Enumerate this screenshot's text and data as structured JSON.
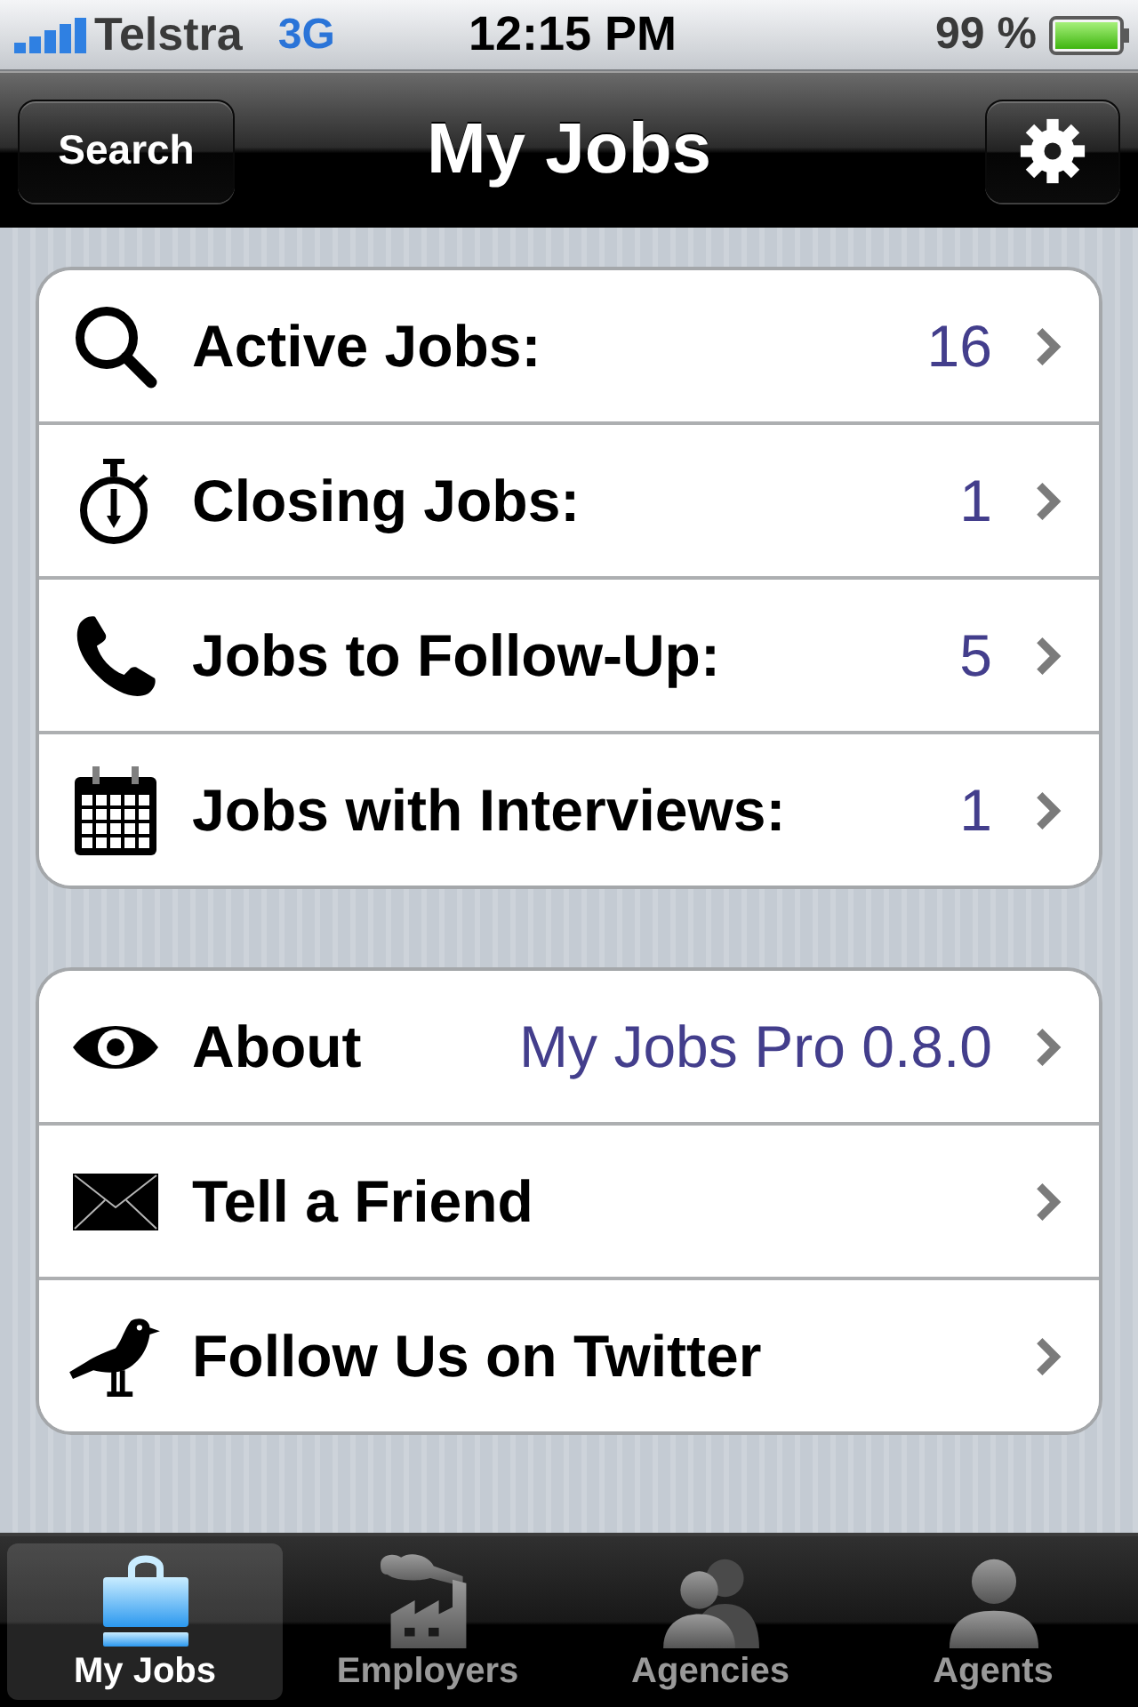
{
  "status_bar": {
    "carrier": "Telstra",
    "network": "3G",
    "time": "12:15 PM",
    "battery": "99 %"
  },
  "nav_bar": {
    "left_button": "Search",
    "title": "My Jobs"
  },
  "groups": [
    {
      "rows": [
        {
          "kind": "search",
          "label": "Active Jobs:",
          "value": "16"
        },
        {
          "kind": "stopwatch",
          "label": "Closing Jobs:",
          "value": "1"
        },
        {
          "kind": "phone",
          "label": "Jobs to Follow-Up:",
          "value": "5"
        },
        {
          "kind": "calendar",
          "label": "Jobs with Interviews:",
          "value": "1"
        }
      ]
    },
    {
      "rows": [
        {
          "kind": "eye",
          "label": "About",
          "value": "My Jobs Pro 0.8.0"
        },
        {
          "kind": "envelope",
          "label": "Tell a Friend"
        },
        {
          "kind": "bird",
          "label": "Follow Us on Twitter"
        }
      ]
    }
  ],
  "tab_bar": {
    "tabs": [
      {
        "kind": "briefcase",
        "label": "My Jobs",
        "selected": true
      },
      {
        "kind": "factory",
        "label": "Employers",
        "selected": false
      },
      {
        "kind": "people",
        "label": "Agencies",
        "selected": false
      },
      {
        "kind": "person",
        "label": "Agents",
        "selected": false
      }
    ]
  }
}
